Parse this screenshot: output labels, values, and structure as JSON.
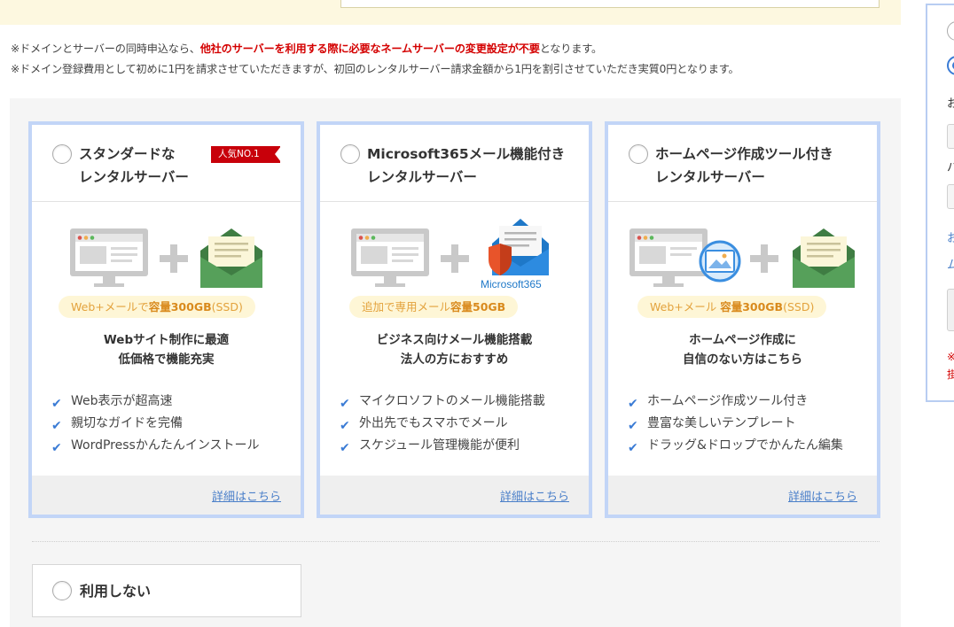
{
  "notes": {
    "line1_prefix": "※ドメインとサーバーの同時申込なら、",
    "line1_highlight": "他社のサーバーを利用する際に必要なネームサーバーの変更設定が不要",
    "line1_suffix": "となります。",
    "line2": "※ドメイン登録費用として初めに1円を請求させていただきますが、初回のレンタルサーバー請求金額から1円を割引させていただき実質0円となります。"
  },
  "plans": [
    {
      "title_line1": "スタンダードな",
      "title_line2": "レンタルサーバー",
      "badge": "人気NO.1",
      "pill_prefix": "Web+メールで",
      "pill_bold": "容量300GB",
      "pill_suffix": "(SSD)",
      "desc_line1": "Webサイト制作に最適",
      "desc_line2": "低価格で機能充実",
      "features": [
        "Web表示が超高速",
        "親切なガイドを完備",
        "WordPressかんたんインストール"
      ],
      "detail_link": "詳細はこちら"
    },
    {
      "title_line1": "Microsoft365メール機能付き",
      "title_line2": "レンタルサーバー",
      "logo_text": "Microsoft365",
      "pill_prefix": "追加で専用メール",
      "pill_bold": "容量50GB",
      "pill_suffix": "",
      "desc_line1": "ビジネス向けメール機能搭載",
      "desc_line2": "法人の方におすすめ",
      "features": [
        "マイクロソフトのメール機能搭載",
        "外出先でもスマホでメール",
        "スケジュール管理機能が便利"
      ],
      "detail_link": "詳細はこちら"
    },
    {
      "title_line1": "ホームページ作成ツール付き",
      "title_line2": "レンタルサーバー",
      "pill_prefix": "Web+メール ",
      "pill_bold": "容量300GB",
      "pill_suffix": "(SSD)",
      "desc_line1": "ホームページ作成に",
      "desc_line2": "自信のない方はこちら",
      "features": [
        "ホームページ作成ツール付き",
        "豊富な美しいテンプレート",
        "ドラッグ&ドロップでかんたん編集"
      ],
      "detail_link": "詳細はこちら"
    }
  ],
  "no_use_label": "利用しない",
  "side": {
    "text1": "お",
    "text2": "パ",
    "link1": "お",
    "link2": "ム",
    "note1": "※",
    "note2": "掛"
  },
  "colors": {
    "accent_blue": "#3a7bd5",
    "card_border": "#c2d5f7",
    "badge_red": "#c8000a",
    "pill_bg": "#fef6d6",
    "pill_text": "#e3a23c"
  }
}
